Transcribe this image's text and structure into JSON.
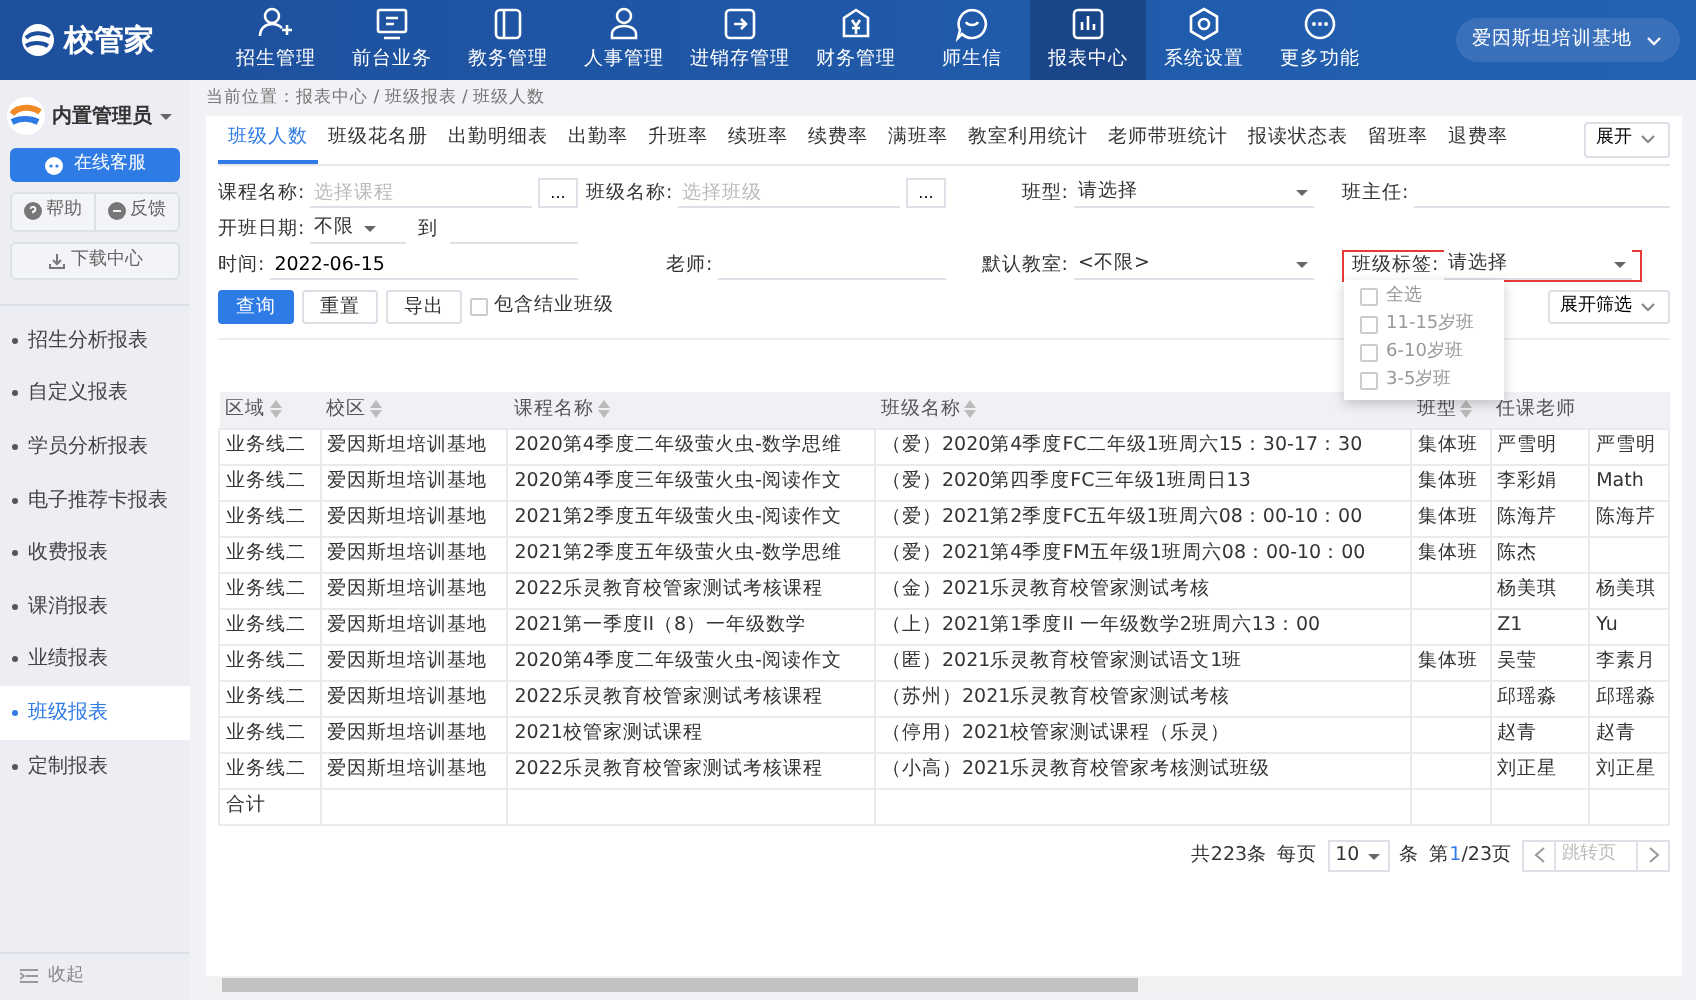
{
  "nav": {
    "logo": "校管家",
    "school": "爱因斯坦培训基地",
    "items": [
      {
        "label": "招生管理",
        "kind": "enroll",
        "selected": false
      },
      {
        "label": "前台业务",
        "kind": "desk",
        "selected": false
      },
      {
        "label": "教务管理",
        "kind": "academic",
        "selected": false
      },
      {
        "label": "人事管理",
        "kind": "staff",
        "selected": false
      },
      {
        "label": "进销存管理",
        "kind": "inventory",
        "selected": false
      },
      {
        "label": "财务管理",
        "kind": "finance",
        "selected": false
      },
      {
        "label": "师生信",
        "kind": "message",
        "selected": false
      },
      {
        "label": "报表中心",
        "kind": "report",
        "selected": true
      },
      {
        "label": "系统设置",
        "kind": "settings",
        "selected": false
      },
      {
        "label": "更多功能",
        "kind": "more",
        "selected": false
      }
    ]
  },
  "sidebar": {
    "user": "内置管理员",
    "service": "在线客服",
    "help": "帮助",
    "feedback": "反馈",
    "download": "下载中心",
    "collapse": "收起",
    "items": [
      {
        "label": "招生分析报表",
        "selected": false
      },
      {
        "label": "自定义报表",
        "selected": false
      },
      {
        "label": "学员分析报表",
        "selected": false
      },
      {
        "label": "电子推荐卡报表",
        "selected": false
      },
      {
        "label": "收费报表",
        "selected": false
      },
      {
        "label": "课消报表",
        "selected": false
      },
      {
        "label": "业绩报表",
        "selected": false
      },
      {
        "label": "班级报表",
        "selected": true
      },
      {
        "label": "定制报表",
        "selected": false
      }
    ]
  },
  "breadcrumb": "当前位置：报表中心 / 班级报表 / 班级人数",
  "tabs": [
    {
      "label": "班级人数",
      "selected": true
    },
    {
      "label": "班级花名册",
      "selected": false
    },
    {
      "label": "出勤明细表",
      "selected": false
    },
    {
      "label": "出勤率",
      "selected": false
    },
    {
      "label": "升班率",
      "selected": false
    },
    {
      "label": "续班率",
      "selected": false
    },
    {
      "label": "续费率",
      "selected": false
    },
    {
      "label": "满班率",
      "selected": false
    },
    {
      "label": "教室利用统计",
      "selected": false
    },
    {
      "label": "老师带班统计",
      "selected": false
    },
    {
      "label": "报读状态表",
      "selected": false
    },
    {
      "label": "留班率",
      "selected": false
    },
    {
      "label": "退费率",
      "selected": false
    }
  ],
  "expand_tabs": "展开",
  "filters": {
    "course": {
      "label": "课程名称:",
      "placeholder": "选择课程",
      "picker": "..."
    },
    "class_name": {
      "label": "班级名称:",
      "placeholder": "选择班级",
      "picker": "..."
    },
    "class_type": {
      "label": "班型:",
      "value": "请选择"
    },
    "head_teacher": {
      "label": "班主任:"
    },
    "open_date": {
      "label": "开班日期:",
      "value": "不限",
      "to": "到"
    },
    "time": {
      "label": "时间:",
      "value": "2022-06-15"
    },
    "teacher": {
      "label": "老师:"
    },
    "classroom": {
      "label": "默认教室:",
      "value": "<不限>"
    },
    "class_tag": {
      "label": "班级标签:",
      "value": "请选择",
      "highlighted": true
    }
  },
  "actions": [
    {
      "label": "查询",
      "kind": "primary"
    },
    {
      "label": "重置",
      "kind": "default"
    },
    {
      "label": "导出",
      "kind": "default"
    }
  ],
  "include_finished": {
    "label": "包含结业班级",
    "checked": false
  },
  "expand_filter": "展开筛选",
  "tag_options": [
    {
      "label": "全选",
      "checked": false
    },
    {
      "label": "11-15岁班",
      "checked": false
    },
    {
      "label": "6-10岁班",
      "checked": false
    },
    {
      "label": "3-5岁班",
      "checked": false
    }
  ],
  "table": {
    "columns": [
      {
        "label": "区域",
        "sortable": true
      },
      {
        "label": "校区",
        "sortable": true
      },
      {
        "label": "课程名称",
        "sortable": true
      },
      {
        "label": "班级名称",
        "sortable": true
      },
      {
        "label": "班型",
        "sortable": true
      },
      {
        "label": "任课老师",
        "sortable": false
      },
      {
        "sortable": false
      }
    ],
    "rows": [
      [
        "业务线二",
        "爱因斯坦培训基地",
        "2020第4季度二年级萤火虫-数学思维",
        "（爱）2020第4季度FC二年级1班周六15：30-17：30",
        "集体班",
        "严雪明",
        "严雪明"
      ],
      [
        "业务线二",
        "爱因斯坦培训基地",
        "2020第4季度三年级萤火虫-阅读作文",
        "（爱）2020第四季度FC三年级1班周日13",
        "集体班",
        "李彩娟",
        "Math"
      ],
      [
        "业务线二",
        "爱因斯坦培训基地",
        "2021第2季度五年级萤火虫-阅读作文",
        "（爱）2021第2季度FC五年级1班周六08：00-10：00",
        "集体班",
        "陈海芹",
        "陈海芹"
      ],
      [
        "业务线二",
        "爱因斯坦培训基地",
        "2021第2季度五年级萤火虫-数学思维",
        "（爱）2021第4季度FM五年级1班周六08：00-10：00",
        "集体班",
        "陈杰",
        ""
      ],
      [
        "业务线二",
        "爱因斯坦培训基地",
        "2022乐灵教育校管家测试考核课程",
        "（金）2021乐灵教育校管家测试考核",
        "",
        "杨美琪",
        "杨美琪"
      ],
      [
        "业务线二",
        "爱因斯坦培训基地",
        "2021第一季度II（8）一年级数学",
        "（上）2021第1季度II 一年级数学2班周六13：00",
        "",
        "Z1",
        "Yu"
      ],
      [
        "业务线二",
        "爱因斯坦培训基地",
        "2020第4季度二年级萤火虫-阅读作文",
        "（匿）2021乐灵教育校管家测试语文1班",
        "集体班",
        "吴莹",
        "李素月"
      ],
      [
        "业务线二",
        "爱因斯坦培训基地",
        "2022乐灵教育校管家测试考核课程",
        "（苏州）2021乐灵教育校管家测试考核",
        "",
        "邱瑶淼",
        "邱瑶淼"
      ],
      [
        "业务线二",
        "爱因斯坦培训基地",
        "2021校管家测试课程",
        "（停用）2021校管家测试课程（乐灵）",
        "",
        "赵青",
        "赵青"
      ],
      [
        "业务线二",
        "爱因斯坦培训基地",
        "2022乐灵教育校管家测试考核课程",
        "（小高）2021乐灵教育校管家考核测试班级",
        "",
        "刘正星",
        "刘正星"
      ]
    ],
    "total_row": [
      "合计"
    ]
  },
  "pagination": {
    "total": "共223条",
    "per_page_label": "每页",
    "per_page": "10",
    "unit": "条",
    "page_prefix": "第",
    "page_current": "1",
    "page_suffix": "/23页",
    "jump_placeholder": "跳转页"
  }
}
